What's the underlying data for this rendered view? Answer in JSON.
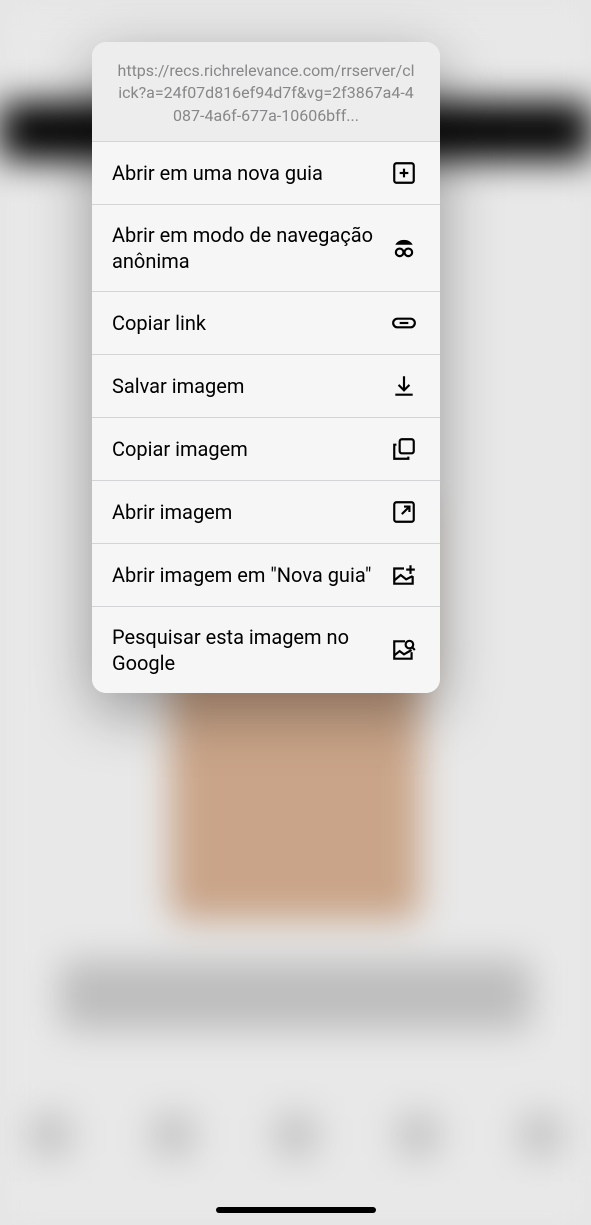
{
  "menu": {
    "url": "https://recs.richrelevance.com/rrserver/click?a=24f07d816ef94d7f&vg=2f3867a4-4087-4a6f-677a-10606bff...",
    "items": [
      {
        "label": "Abrir em uma nova guia",
        "icon": "plus-box-icon"
      },
      {
        "label": "Abrir em modo de navegação anônima",
        "icon": "incognito-icon"
      },
      {
        "label": "Copiar link",
        "icon": "link-icon"
      },
      {
        "label": "Salvar imagem",
        "icon": "download-icon"
      },
      {
        "label": "Copiar imagem",
        "icon": "copy-icon"
      },
      {
        "label": "Abrir imagem",
        "icon": "open-external-icon"
      },
      {
        "label": "Abrir imagem em \"Nova guia\"",
        "icon": "image-add-icon"
      },
      {
        "label": "Pesquisar esta imagem no Google",
        "icon": "image-search-icon"
      }
    ]
  }
}
